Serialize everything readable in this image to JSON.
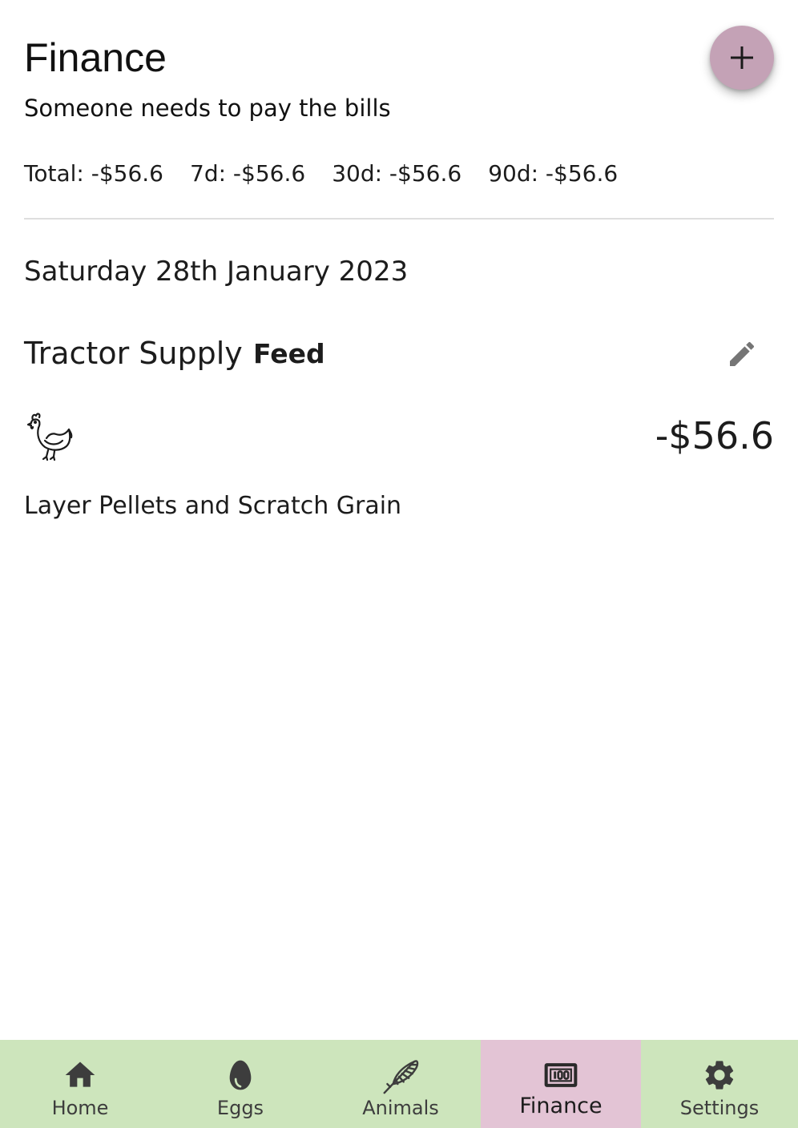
{
  "header": {
    "title": "Finance",
    "subtitle": "Someone needs to pay the bills",
    "add_button_icon": "plus-icon"
  },
  "totals": [
    {
      "label": "Total: -$56.6"
    },
    {
      "label": "7d: -$56.6"
    },
    {
      "label": "30d: -$56.6"
    },
    {
      "label": "90d: -$56.6"
    }
  ],
  "day": {
    "date": "Saturday 28th January 2023",
    "entries": [
      {
        "vendor": "Tractor Supply",
        "category": "Feed",
        "amount": "-$56.6",
        "notes": "Layer Pellets and Scratch Grain",
        "animal_icon": "chicken-icon",
        "edit_icon": "pencil-icon"
      }
    ]
  },
  "bottom_nav": {
    "active": "Finance",
    "items": [
      {
        "label": "Home",
        "icon": "home-icon"
      },
      {
        "label": "Eggs",
        "icon": "egg-icon"
      },
      {
        "label": "Animals",
        "icon": "feather-icon"
      },
      {
        "label": "Finance",
        "icon": "money-icon"
      },
      {
        "label": "Settings",
        "icon": "gear-icon"
      }
    ]
  },
  "colors": {
    "fab": "#c4a2b6",
    "nav_background": "#cde5bc",
    "nav_active": "#e3c4d5",
    "icon_gray": "#757575"
  }
}
